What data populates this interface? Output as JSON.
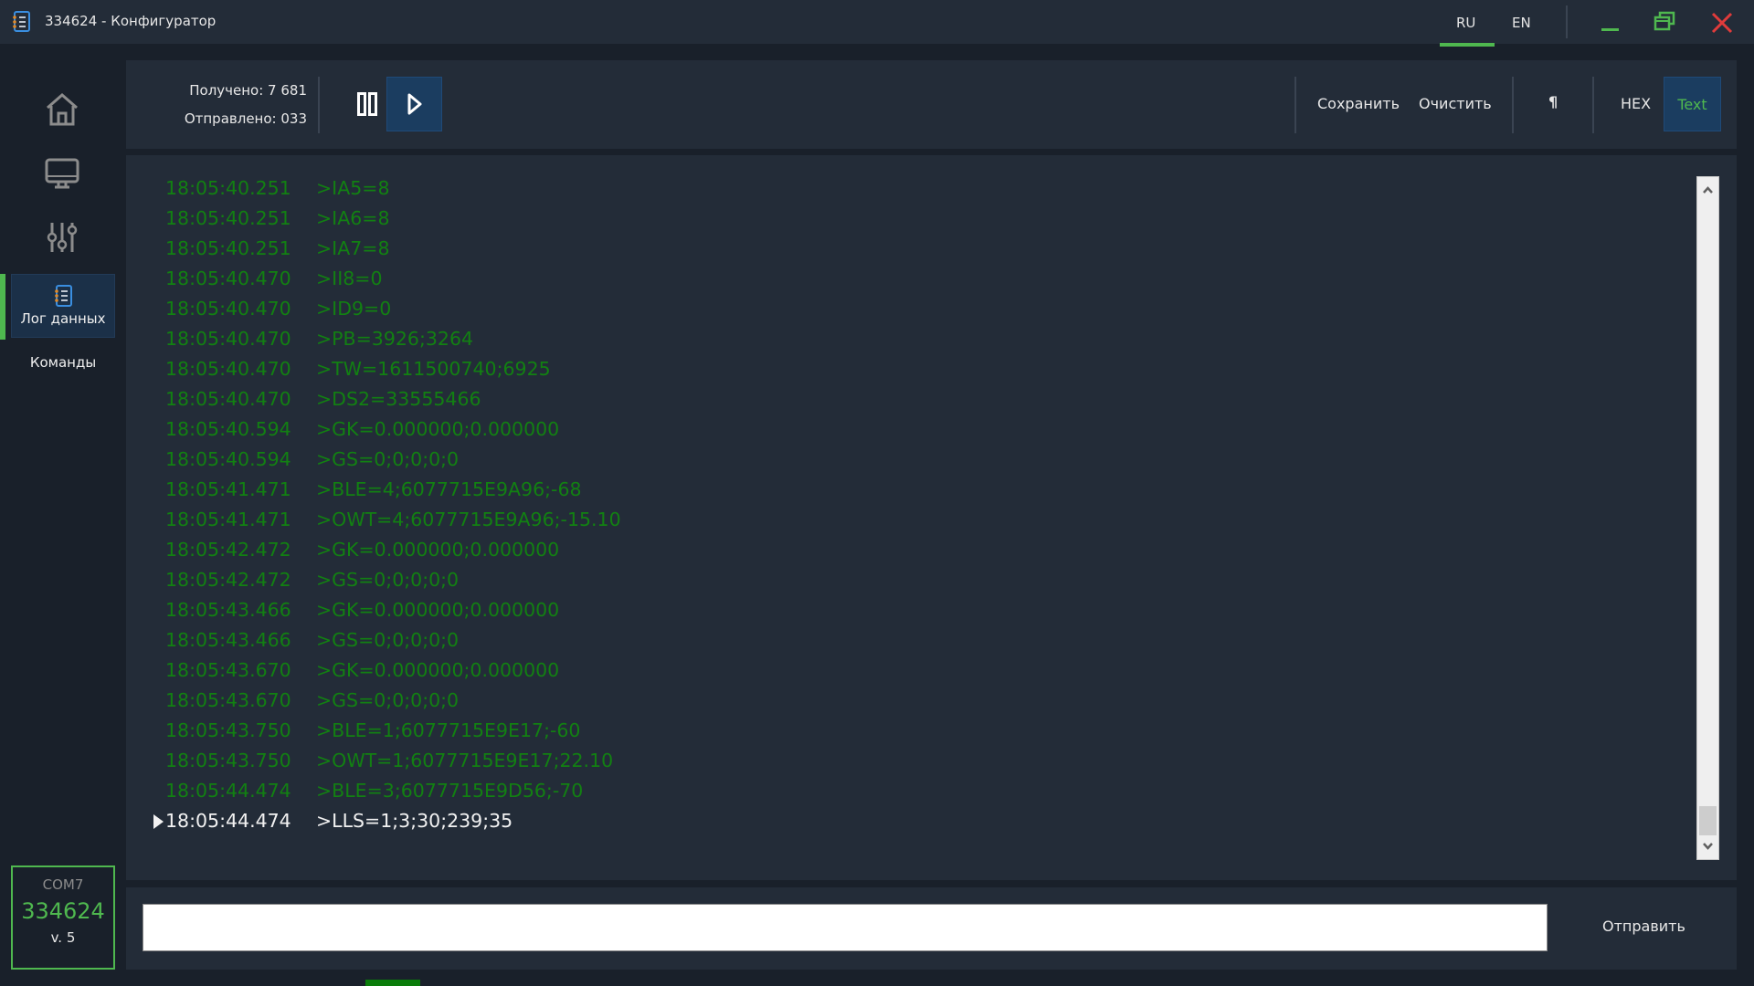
{
  "window": {
    "title": "334624 - Конфигуратор",
    "languages": [
      "RU",
      "EN"
    ],
    "active_language": "RU",
    "controls": [
      "minimize",
      "restore",
      "close"
    ]
  },
  "colors": {
    "accent_green": "#4fb84f",
    "log_green": "#128012",
    "active_blue": "#1b3d60",
    "close_red": "#e03b3b"
  },
  "sidebar": {
    "items": [
      {
        "icon": "home-icon",
        "label": ""
      },
      {
        "icon": "monitor-icon",
        "label": ""
      },
      {
        "icon": "sliders-icon",
        "label": ""
      },
      {
        "icon": "notebook-icon",
        "label": "Лог данных",
        "active": true
      },
      {
        "icon": "",
        "label": "Команды"
      }
    ],
    "device": {
      "port": "COM7",
      "id": "334624",
      "version": "v. 5"
    }
  },
  "toolbar": {
    "received": "Получено: 7 681",
    "sent": "Отправлено: 033",
    "save_label": "Сохранить",
    "clear_label": "Очистить",
    "pilcrow_label": "¶",
    "hex_label": "HEX",
    "text_label": "Text",
    "active_mode": "Text"
  },
  "log": {
    "lines": [
      {
        "time": "18:05:40.251",
        "msg": ">IA5=8"
      },
      {
        "time": "18:05:40.251",
        "msg": ">IA6=8"
      },
      {
        "time": "18:05:40.251",
        "msg": ">IA7=8"
      },
      {
        "time": "18:05:40.470",
        "msg": ">II8=0"
      },
      {
        "time": "18:05:40.470",
        "msg": ">ID9=0"
      },
      {
        "time": "18:05:40.470",
        "msg": ">PB=3926;3264"
      },
      {
        "time": "18:05:40.470",
        "msg": ">TW=1611500740;6925"
      },
      {
        "time": "18:05:40.470",
        "msg": ">DS2=33555466"
      },
      {
        "time": "18:05:40.594",
        "msg": ">GK=0.000000;0.000000"
      },
      {
        "time": "18:05:40.594",
        "msg": ">GS=0;0;0;0;0"
      },
      {
        "time": "18:05:41.471",
        "msg": ">BLE=4;6077715E9A96;-68"
      },
      {
        "time": "18:05:41.471",
        "msg": ">OWT=4;6077715E9A96;-15.10"
      },
      {
        "time": "18:05:42.472",
        "msg": ">GK=0.000000;0.000000"
      },
      {
        "time": "18:05:42.472",
        "msg": ">GS=0;0;0;0;0"
      },
      {
        "time": "18:05:43.466",
        "msg": ">GK=0.000000;0.000000"
      },
      {
        "time": "18:05:43.466",
        "msg": ">GS=0;0;0;0;0"
      },
      {
        "time": "18:05:43.670",
        "msg": ">GK=0.000000;0.000000"
      },
      {
        "time": "18:05:43.670",
        "msg": ">GS=0;0;0;0;0"
      },
      {
        "time": "18:05:43.750",
        "msg": ">BLE=1;6077715E9E17;-60"
      },
      {
        "time": "18:05:43.750",
        "msg": ">OWT=1;6077715E9E17;22.10"
      },
      {
        "time": "18:05:44.474",
        "msg": ">BLE=3;6077715E9D56;-70"
      },
      {
        "time": "18:05:44.474",
        "msg": ">LLS=1;3;30;239;35",
        "current": true
      }
    ]
  },
  "command": {
    "value": "",
    "placeholder": "",
    "send_label": "Отправить"
  }
}
